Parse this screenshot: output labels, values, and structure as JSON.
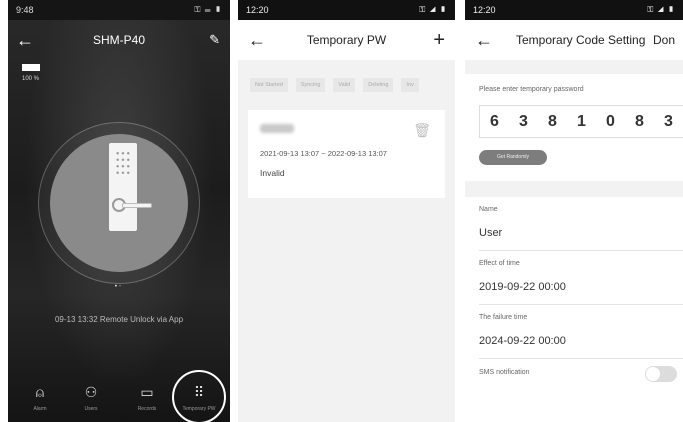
{
  "screen1": {
    "status_time": "9:48",
    "status_icons": "⚿ ☰ ▮",
    "title": "SHM-P40",
    "battery_pct": "100 %",
    "last_event": "09-13 13:32  Remote Unlock via App",
    "pager": "•",
    "tabs": [
      {
        "icon": "alarm-icon",
        "glyph": "⍝",
        "label": "Alarm"
      },
      {
        "icon": "users-icon",
        "glyph": "⚇",
        "label": "Users"
      },
      {
        "icon": "records-icon",
        "glyph": "▭",
        "label": "Records"
      },
      {
        "icon": "temporary-icon",
        "glyph": "⠿",
        "label": "Temporary PW"
      }
    ]
  },
  "screen2": {
    "status_time": "12:20",
    "status_icons": "⚿ ◢ ▮",
    "title": "Temporary PW",
    "filters": [
      "Not Started",
      "Syncing",
      "Valid",
      "Deleting",
      "Inv"
    ],
    "password": {
      "range": "2021-09-13 13:07 ~ 2022-09-13 13:07",
      "status": "Invalid"
    }
  },
  "screen3": {
    "status_time": "12:20",
    "status_icons": "⚿ ◢ ▮",
    "title": "Temporary Code Setting",
    "done_label": "Don",
    "hint": "Please enter temporary password",
    "digits": [
      "6",
      "3",
      "8",
      "1",
      "0",
      "8",
      "3"
    ],
    "random_button": "Get Randomly",
    "name_label": "Name",
    "name_value": "User",
    "effect_label": "Effect of time",
    "effect_value": "2019-09-22 00:00",
    "failure_label": "The failure time",
    "failure_value": "2024-09-22 00:00",
    "sms_label": "SMS notification",
    "sms_enabled": false
  }
}
